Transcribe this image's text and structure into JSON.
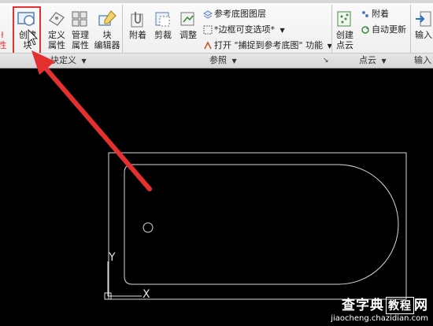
{
  "ribbon": {
    "block_panel": {
      "create_block_label": "创建\n块",
      "define_attribute_label": "定义\n属性",
      "manage_attribute_label": "管理\n属性",
      "block_editor_label": "块\n编辑器",
      "panel_title": "块定义",
      "left_cut_label": "ł\n性"
    },
    "reference_panel": {
      "attach_label": "附着",
      "clip_label": "剪裁",
      "adjust_label": "调整",
      "underlay_layers_label": "参考底图图层",
      "frame_variable_label": "*边框可变选项*",
      "snap_to_underlay_label": "打开 \"捕捉到参考底图\" 功能",
      "panel_title": "参照"
    },
    "pointcloud_panel": {
      "create_pointcloud_label": "创建\n点云",
      "attach_label": "附着",
      "auto_update_label": "自动更新",
      "panel_title": "点云"
    },
    "import_panel": {
      "import_label": "输入",
      "panel_title": "输入"
    }
  },
  "canvas": {
    "ucs_y_label": "Y",
    "ucs_x_label": "X"
  },
  "watermark": {
    "brand": "查字典",
    "site_box": "教程",
    "site_suffix": "网",
    "url": "jiaocheng.chazidian.com"
  },
  "colors": {
    "annotation_red": "#e53030",
    "canvas_bg": "#000000",
    "drawing_lines": "#d8d8d8"
  }
}
